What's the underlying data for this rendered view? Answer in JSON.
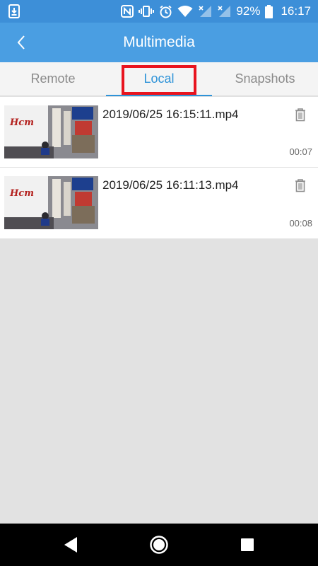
{
  "status_bar": {
    "battery": "92%",
    "time": "16:17"
  },
  "header": {
    "title": "Multimedia",
    "back_icon": "chevron-left-icon"
  },
  "tabs": [
    {
      "label": "Remote",
      "active": false
    },
    {
      "label": "Local",
      "active": true
    },
    {
      "label": "Snapshots",
      "active": false
    }
  ],
  "files": [
    {
      "name": "2019/06/25 16:15:11.mp4",
      "duration": "00:07"
    },
    {
      "name": "2019/06/25 16:11:13.mp4",
      "duration": "00:08"
    }
  ],
  "colors": {
    "status_bar": "#3d8fd8",
    "header": "#4a9ee2",
    "active_tab": "#2e93d8",
    "highlight": "#e8141e"
  }
}
